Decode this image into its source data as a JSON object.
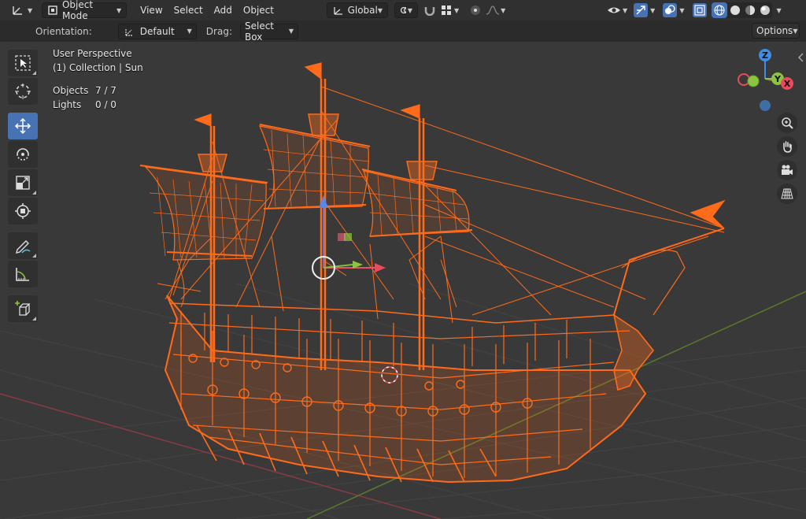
{
  "header": {
    "mode": "Object Mode",
    "menus": [
      "View",
      "Select",
      "Add",
      "Object"
    ],
    "transform_orientation": "Global"
  },
  "tool_settings": {
    "orientation_label": "Orientation:",
    "orientation_value": "Default",
    "drag_label": "Drag:",
    "drag_value": "Select Box",
    "options_label": "Options"
  },
  "viewport": {
    "view_name": "User Perspective",
    "collection": "(1) Collection | Sun",
    "stats": [
      {
        "label": "Objects",
        "value": "7 / 7"
      },
      {
        "label": "Lights",
        "value": "0 / 0"
      }
    ]
  },
  "gizmo": {
    "axis_z": "Z",
    "axis_y": "Y",
    "axis_x": "X",
    "colors": {
      "x": "#e94a5c",
      "y": "#8bc53f",
      "z": "#3e8ee6"
    }
  },
  "tools": [
    "select-box",
    "cursor",
    "move",
    "rotate",
    "scale",
    "transform",
    "annotate",
    "measure",
    "add-cube"
  ],
  "nav_icons": [
    "zoom-icon",
    "pan-hand-icon",
    "camera-icon",
    "grid-view-icon"
  ],
  "colors": {
    "wire": "#ff6b1a",
    "accent": "#4772b3",
    "viewport_bg": "#393939"
  }
}
